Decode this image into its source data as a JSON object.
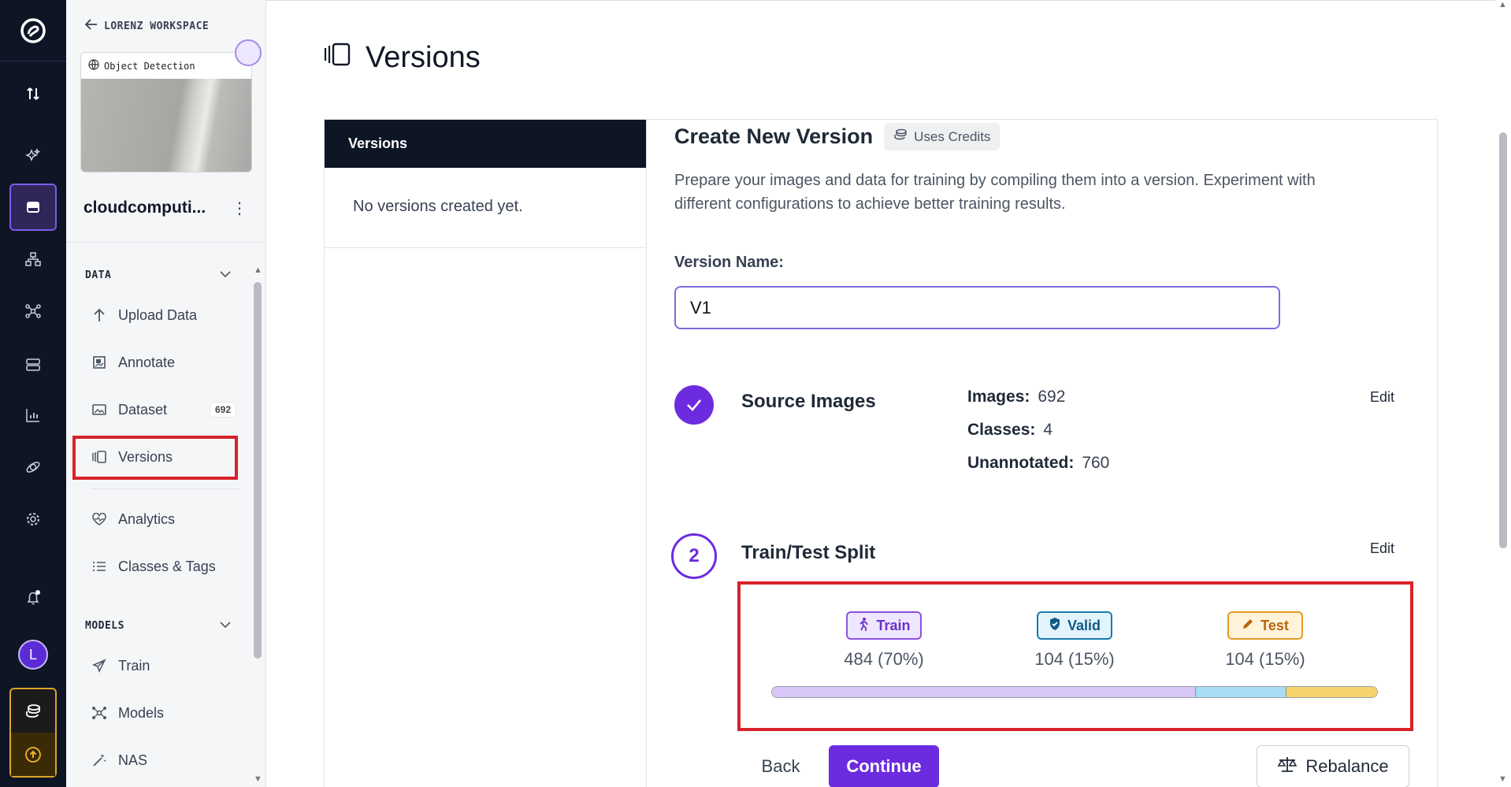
{
  "workspace": {
    "back_label": "LORENZ WORKSPACE"
  },
  "project": {
    "type_label": "Object Detection",
    "name": "cloudcomputi..."
  },
  "sidebar": {
    "data_section": "DATA",
    "models_section": "MODELS",
    "items": [
      {
        "label": "Upload Data",
        "icon": "upload-arrow-icon"
      },
      {
        "label": "Annotate",
        "icon": "annotate-icon"
      },
      {
        "label": "Dataset",
        "icon": "image-icon",
        "badge": "692"
      },
      {
        "label": "Versions",
        "icon": "versions-icon"
      },
      {
        "label": "Analytics",
        "icon": "heart-pulse-icon"
      },
      {
        "label": "Classes & Tags",
        "icon": "list-icon"
      }
    ],
    "model_items": [
      {
        "label": "Train",
        "icon": "send-icon"
      },
      {
        "label": "Models",
        "icon": "nodes-icon"
      },
      {
        "label": "NAS",
        "icon": "wand-icon"
      }
    ]
  },
  "user": {
    "initial": "L"
  },
  "page": {
    "title": "Versions"
  },
  "versions_list": {
    "header": "Versions",
    "empty_text": "No versions created yet."
  },
  "create": {
    "title": "Create New Version",
    "credits_label": "Uses Credits",
    "description": "Prepare your images and data for training by compiling them into a version. Experiment with different configurations to achieve better training results.",
    "version_name_label": "Version Name:",
    "version_name_value": "V1"
  },
  "source_images": {
    "title": "Source Images",
    "edit_label": "Edit",
    "images_label": "Images:",
    "images_value": "692",
    "classes_label": "Classes:",
    "classes_value": "4",
    "unannotated_label": "Unannotated:",
    "unannotated_value": "760"
  },
  "split": {
    "step_number": "2",
    "title": "Train/Test Split",
    "edit_label": "Edit",
    "train_label": "Train",
    "train_count": "484 (70%)",
    "valid_label": "Valid",
    "valid_count": "104 (15%)",
    "test_label": "Test",
    "test_count": "104 (15%)",
    "fractions": {
      "train": 0.7,
      "valid": 0.15,
      "test": 0.15
    },
    "colors": {
      "train": "#d7c6f7",
      "valid": "#a9dcf5",
      "test": "#f6d36b"
    }
  },
  "actions": {
    "back_label": "Back",
    "continue_label": "Continue",
    "rebalance_label": "Rebalance"
  },
  "colors": {
    "accent": "#6d2be0",
    "highlight": "#d8222a",
    "rail": "#0e1525"
  }
}
